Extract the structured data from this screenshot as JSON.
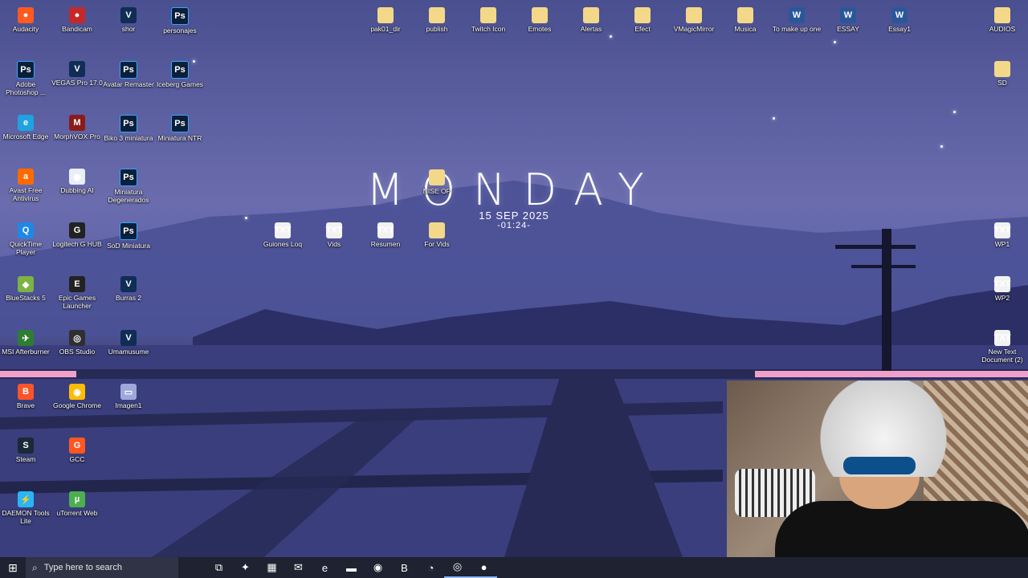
{
  "wallpaper": {
    "day": "MONDAY",
    "date": "15 SEP 2025",
    "time": "-01:24-"
  },
  "desktop_icons": [
    {
      "label": "Audacity",
      "kind": "round",
      "color": "#ff5a1f",
      "glyph": "●"
    },
    {
      "label": "Bandicam",
      "kind": "red",
      "color": "#c62828",
      "glyph": "●"
    },
    {
      "label": "shor",
      "kind": "v",
      "glyph": "V"
    },
    {
      "label": "personajes",
      "kind": "ps",
      "glyph": "Ps"
    },
    {
      "label": "Adobe Photoshop ...",
      "kind": "ps",
      "glyph": "Ps"
    },
    {
      "label": "VEGAS Pro 17.0",
      "kind": "v",
      "glyph": "V"
    },
    {
      "label": "Avatar Remaster",
      "kind": "ps",
      "glyph": "Ps"
    },
    {
      "label": "Iceberg Games",
      "kind": "ps",
      "glyph": "Ps"
    },
    {
      "label": "Microsoft Edge",
      "kind": "round",
      "color": "#1fa2e0",
      "glyph": "e"
    },
    {
      "label": "MorphVOX Pro",
      "kind": "round",
      "color": "#8b1b1b",
      "glyph": "M"
    },
    {
      "label": "Biko 3 miniatura",
      "kind": "ps",
      "glyph": "Ps"
    },
    {
      "label": "Miniatura NTR",
      "kind": "ps",
      "glyph": "Ps"
    },
    {
      "label": "Avast Free Antivirus",
      "kind": "round",
      "color": "#ff6a00",
      "glyph": "a"
    },
    {
      "label": "Dubbing AI",
      "kind": "round",
      "color": "#e9eef7",
      "glyph": "◉"
    },
    {
      "label": "Miniatura Degenerados",
      "kind": "ps",
      "glyph": "Ps"
    },
    {
      "label": "QuickTime Player",
      "kind": "round",
      "color": "#1e88e5",
      "glyph": "Q"
    },
    {
      "label": "Logitech G HUB",
      "kind": "round",
      "color": "#222",
      "glyph": "G"
    },
    {
      "label": "SoD Miniatura",
      "kind": "ps",
      "glyph": "Ps"
    },
    {
      "label": "BlueStacks 5",
      "kind": "round",
      "color": "#7cb342",
      "glyph": "◆"
    },
    {
      "label": "Epic Games Launcher",
      "kind": "round",
      "color": "#222",
      "glyph": "E"
    },
    {
      "label": "Burras 2",
      "kind": "v",
      "glyph": "V"
    },
    {
      "label": "MSI Afterburner",
      "kind": "round",
      "color": "#2e7d32",
      "glyph": "✈"
    },
    {
      "label": "OBS Studio",
      "kind": "round",
      "color": "#302e31",
      "glyph": "◎"
    },
    {
      "label": "Umamusume",
      "kind": "v",
      "glyph": "V"
    },
    {
      "label": "Brave",
      "kind": "round",
      "color": "#fb542b",
      "glyph": "B"
    },
    {
      "label": "Google Chrome",
      "kind": "round",
      "color": "#fbbc05",
      "glyph": "◉"
    },
    {
      "label": "Imagen1",
      "kind": "round",
      "color": "#9fa8da",
      "glyph": "▭"
    },
    {
      "label": "Steam",
      "kind": "round",
      "color": "#1b2838",
      "glyph": "S"
    },
    {
      "label": "GCC",
      "kind": "round",
      "color": "#ff5722",
      "glyph": "G"
    },
    {
      "label": "DAEMON Tools Lite",
      "kind": "round",
      "color": "#29b6f6",
      "glyph": "⚡"
    },
    {
      "label": "uTorrent Web",
      "kind": "round",
      "color": "#4caf50",
      "glyph": "µ"
    },
    {
      "label": "pak01_dir",
      "kind": "folder"
    },
    {
      "label": "publish",
      "kind": "folder"
    },
    {
      "label": "Twitch Icon",
      "kind": "folder"
    },
    {
      "label": "Emotes",
      "kind": "folder"
    },
    {
      "label": "Alertas",
      "kind": "folder"
    },
    {
      "label": "Efect",
      "kind": "folder"
    },
    {
      "label": "VMagicMirror",
      "kind": "folder"
    },
    {
      "label": "Musica",
      "kind": "folder"
    },
    {
      "label": "To make up one",
      "kind": "word",
      "glyph": "W"
    },
    {
      "label": "ESSAY",
      "kind": "word",
      "glyph": "W"
    },
    {
      "label": "Essay1",
      "kind": "word",
      "glyph": "W"
    },
    {
      "label": "AUDIOS",
      "kind": "folder"
    },
    {
      "label": "SD",
      "kind": "folder"
    },
    {
      "label": "NISE OP",
      "kind": "folder"
    },
    {
      "label": "Guiones Loq",
      "kind": "txt",
      "glyph": "TXT"
    },
    {
      "label": "Vids",
      "kind": "txt",
      "glyph": "TXT"
    },
    {
      "label": "Resumen",
      "kind": "txt",
      "glyph": "TXT"
    },
    {
      "label": "For Vids",
      "kind": "folder"
    },
    {
      "label": "WP1",
      "kind": "txt",
      "glyph": "TXT"
    },
    {
      "label": "WP2",
      "kind": "txt",
      "glyph": "TXT"
    },
    {
      "label": "New Text Document (2)",
      "kind": "txt",
      "glyph": "TXT"
    }
  ],
  "taskbar": {
    "start_glyph": "⊞",
    "search_placeholder": "Type here to search",
    "search_glyph": "⌕",
    "pinned": [
      {
        "name": "task-view",
        "glyph": "⧉"
      },
      {
        "name": "copilot",
        "glyph": "✦"
      },
      {
        "name": "microsoft-store",
        "glyph": "▦"
      },
      {
        "name": "outlook",
        "glyph": "✉"
      },
      {
        "name": "edge",
        "glyph": "e"
      },
      {
        "name": "file-explorer",
        "glyph": "▬"
      },
      {
        "name": "chrome",
        "glyph": "◉"
      },
      {
        "name": "brave",
        "glyph": "B"
      },
      {
        "name": "discord",
        "glyph": "◔"
      },
      {
        "name": "obs",
        "glyph": "◎"
      },
      {
        "name": "bandicam",
        "glyph": "●"
      }
    ]
  }
}
